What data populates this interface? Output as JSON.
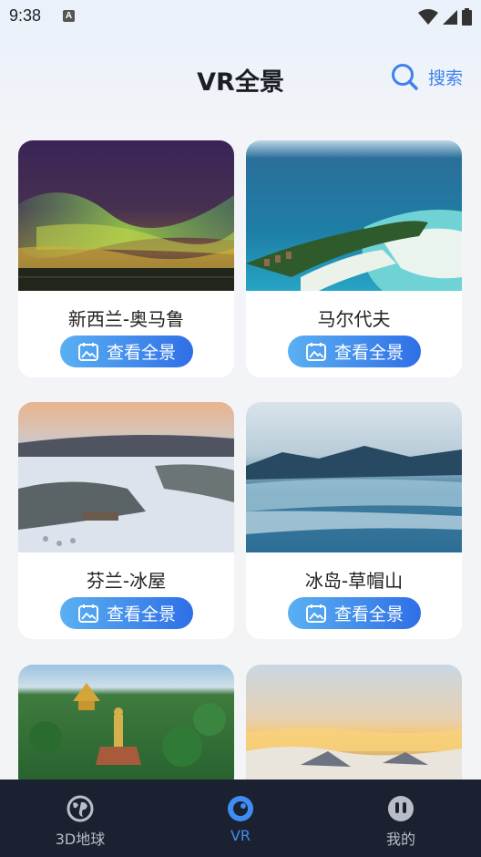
{
  "status_bar": {
    "time": "9:38",
    "indicator": "A"
  },
  "header": {
    "title": "VR全景",
    "search_label": "搜索"
  },
  "cards": [
    {
      "name": "新西兰-奥马鲁",
      "button": "查看全景"
    },
    {
      "name": "马尔代夫",
      "button": "查看全景"
    },
    {
      "name": "芬兰-冰屋",
      "button": "查看全景"
    },
    {
      "name": "冰岛-草帽山",
      "button": "查看全景"
    },
    {
      "name": "",
      "button": ""
    },
    {
      "name": "",
      "button": ""
    }
  ],
  "tabs": [
    {
      "label": "3D地球",
      "icon": "globe-icon",
      "active": false
    },
    {
      "label": "VR",
      "icon": "vr-eye-icon",
      "active": true
    },
    {
      "label": "我的",
      "icon": "profile-face-icon",
      "active": false
    }
  ],
  "colors": {
    "accent": "#3c82ec",
    "tab_bar": "#1b2130",
    "button_start": "#5ab0f2",
    "button_end": "#2f6fe6"
  }
}
